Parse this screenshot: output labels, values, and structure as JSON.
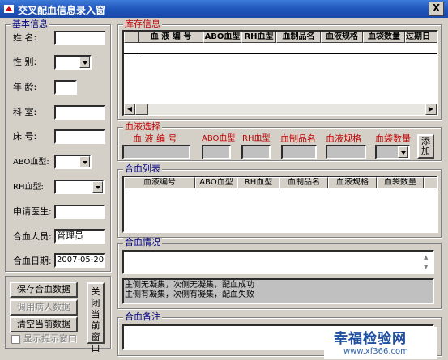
{
  "window": {
    "title": "交叉配血信息录入窗",
    "close": "X"
  },
  "basic": {
    "legend": "基本信息",
    "fields": {
      "name": {
        "label": "姓  名:",
        "value": ""
      },
      "sex": {
        "label": "性  别:",
        "value": ""
      },
      "age": {
        "label": "年  龄:",
        "value": ""
      },
      "dept": {
        "label": "科  室:",
        "value": ""
      },
      "bed": {
        "label": "床  号:",
        "value": ""
      },
      "abo": {
        "label": "ABO血型:",
        "value": ""
      },
      "rh": {
        "label": "RH血型:",
        "value": ""
      },
      "doctor": {
        "label": "申请医生:",
        "value": ""
      },
      "operator": {
        "label": "合血人员:",
        "value": "管理员"
      },
      "date": {
        "label": "合血日期:",
        "value": "2007-05-20"
      }
    }
  },
  "stock": {
    "legend": "库存信息",
    "columns": [
      "血 液 编 号",
      "ABO血型",
      "RH血型",
      "血制品名",
      "血液规格",
      "血袋数量",
      "过期日"
    ]
  },
  "blood_select": {
    "legend": "血液选择",
    "labels": [
      "血 液 编 号",
      "ABO血型",
      "RH血型",
      "血制品名",
      "血液规格",
      "血袋数量"
    ],
    "add_button": "添加"
  },
  "match_list": {
    "legend": "合血列表",
    "columns": [
      "血液编号",
      "ABO血型",
      "RH血型",
      "血制品名",
      "血液规格",
      "血袋数量"
    ]
  },
  "match_result": {
    "legend": "合血情况",
    "options": [
      "主侧无凝集，次侧无凝集，配血成功",
      "主侧有凝集，次侧有凝集，配血失败"
    ]
  },
  "notes": {
    "legend": "合血备注"
  },
  "buttons": {
    "save": "保存合血数据",
    "load_patient": "调用病人数据",
    "clear": "清空当前数据",
    "close_window": "关闭当前窗口",
    "show_tip": "显示提示窗口"
  },
  "watermark": {
    "main": "幸福检验网",
    "url": "www.xf366.com"
  }
}
